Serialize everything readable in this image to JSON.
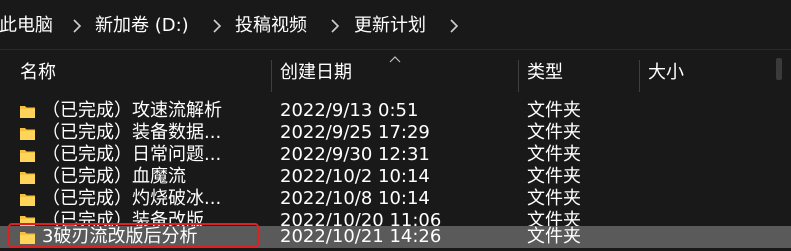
{
  "breadcrumb": {
    "items": [
      "此电脑",
      "新加卷 (D:)",
      "投稿视频",
      "更新计划"
    ]
  },
  "columns": {
    "name": "名称",
    "date_modified": "创建日期",
    "type": "类型",
    "size": "大小"
  },
  "sort_indicator_icon": "chevron-up-icon",
  "folder_icon_color": "#f5c13d",
  "selection_outline_color": "#e02020",
  "files": [
    {
      "name": "（已完成）攻速流解析",
      "date": "2022/9/13 0:51",
      "type": "文件夹"
    },
    {
      "name": "（已完成）装备数据...",
      "date": "2022/9/25 17:29",
      "type": "文件夹"
    },
    {
      "name": "（已完成）日常问题...",
      "date": "2022/9/30 12:31",
      "type": "文件夹"
    },
    {
      "name": "（已完成）血魔流",
      "date": "2022/10/2 10:14",
      "type": "文件夹"
    },
    {
      "name": "（已完成）灼烧破冰...",
      "date": "2022/10/8 10:14",
      "type": "文件夹"
    },
    {
      "name": "（已完成）装备改版",
      "date": "2022/10/20 11:06",
      "type": "文件夹"
    },
    {
      "name": "3破刃流改版后分析",
      "date": "2022/10/21 14:26",
      "type": "文件夹",
      "selected": true
    }
  ]
}
